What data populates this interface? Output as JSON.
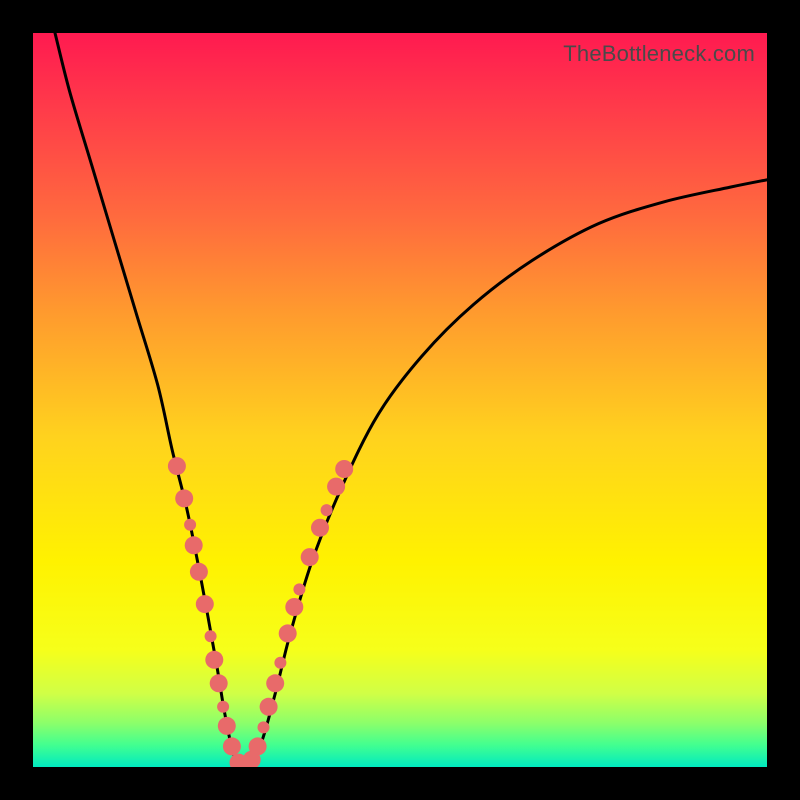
{
  "watermark": "TheBottleneck.com",
  "chart_data": {
    "type": "line",
    "title": "",
    "xlabel": "",
    "ylabel": "",
    "xlim": [
      0,
      100
    ],
    "ylim": [
      0,
      100
    ],
    "series": [
      {
        "name": "bottleneck-curve",
        "x": [
          3,
          5,
          8,
          11,
          14,
          17,
          19,
          21,
          23,
          25,
          26,
          27,
          28,
          29,
          31,
          33,
          35,
          38,
          42,
          47,
          53,
          60,
          68,
          77,
          86,
          95,
          100
        ],
        "y": [
          100,
          92,
          82,
          72,
          62,
          52,
          43,
          35,
          25,
          14,
          8,
          3,
          0,
          0,
          3,
          10,
          18,
          28,
          38,
          48,
          56,
          63,
          69,
          74,
          77,
          79,
          80
        ]
      }
    ],
    "markers": {
      "name": "highlighted-points",
      "color": "#e86a6a",
      "radius_main": 9,
      "radius_minor": 6,
      "points": [
        {
          "x": 19.6,
          "y": 41.0,
          "r": 9
        },
        {
          "x": 20.6,
          "y": 36.6,
          "r": 9
        },
        {
          "x": 21.4,
          "y": 33.0,
          "r": 6
        },
        {
          "x": 21.9,
          "y": 30.2,
          "r": 9
        },
        {
          "x": 22.6,
          "y": 26.6,
          "r": 9
        },
        {
          "x": 23.4,
          "y": 22.2,
          "r": 9
        },
        {
          "x": 24.2,
          "y": 17.8,
          "r": 6
        },
        {
          "x": 24.7,
          "y": 14.6,
          "r": 9
        },
        {
          "x": 25.3,
          "y": 11.4,
          "r": 9
        },
        {
          "x": 25.9,
          "y": 8.2,
          "r": 6
        },
        {
          "x": 26.4,
          "y": 5.6,
          "r": 9
        },
        {
          "x": 27.1,
          "y": 2.8,
          "r": 9
        },
        {
          "x": 28.0,
          "y": 0.6,
          "r": 9
        },
        {
          "x": 28.9,
          "y": 0.2,
          "r": 9
        },
        {
          "x": 29.8,
          "y": 1.0,
          "r": 9
        },
        {
          "x": 30.6,
          "y": 2.8,
          "r": 9
        },
        {
          "x": 31.4,
          "y": 5.4,
          "r": 6
        },
        {
          "x": 32.1,
          "y": 8.2,
          "r": 9
        },
        {
          "x": 33.0,
          "y": 11.4,
          "r": 9
        },
        {
          "x": 33.7,
          "y": 14.2,
          "r": 6
        },
        {
          "x": 34.7,
          "y": 18.2,
          "r": 9
        },
        {
          "x": 35.6,
          "y": 21.8,
          "r": 9
        },
        {
          "x": 36.3,
          "y": 24.2,
          "r": 6
        },
        {
          "x": 37.7,
          "y": 28.6,
          "r": 9
        },
        {
          "x": 39.1,
          "y": 32.6,
          "r": 9
        },
        {
          "x": 40.0,
          "y": 35.0,
          "r": 6
        },
        {
          "x": 41.3,
          "y": 38.2,
          "r": 9
        },
        {
          "x": 42.4,
          "y": 40.6,
          "r": 9
        }
      ]
    }
  }
}
